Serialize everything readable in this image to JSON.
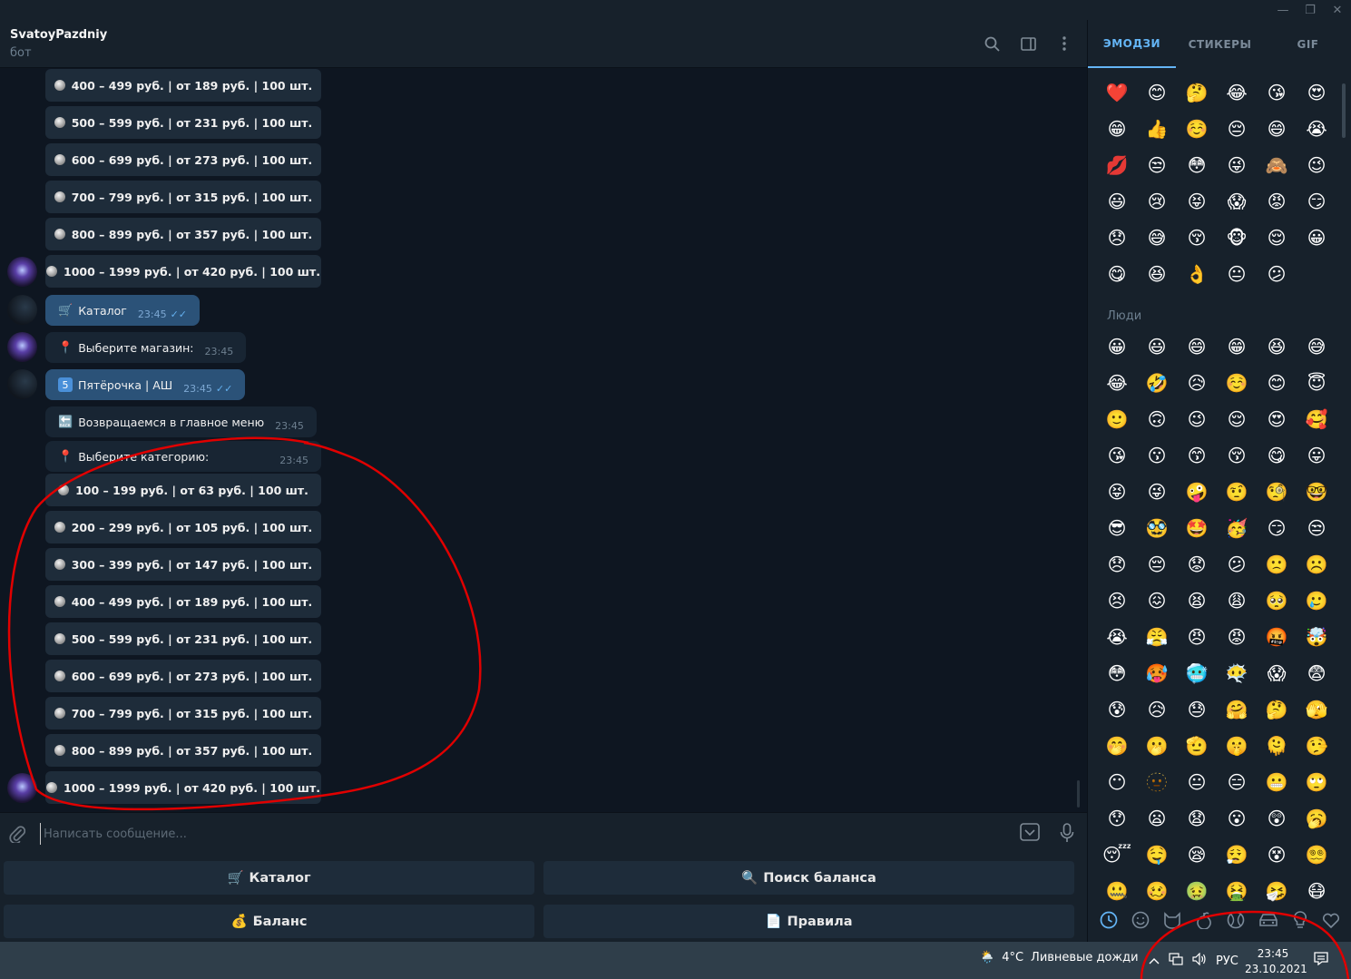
{
  "window": {
    "minimize": "—",
    "maximize": "❐",
    "close": "✕"
  },
  "chat": {
    "title": "SvatoyPazdniy",
    "subtitle": "бот"
  },
  "top_buttons": [
    "400 – 499 руб. | от 189 руб. | 100 шт.",
    "500 – 599 руб. | от 231 руб. | 100 шт.",
    "600 – 699 руб. | от 273 руб. | 100 шт.",
    "700 – 799 руб. | от 315 руб. | 100 шт.",
    "800 – 899 руб. | от 357 руб. | 100 шт.",
    "1000 – 1999 руб. | от 420 руб. | 100 шт."
  ],
  "messages": {
    "catalog": {
      "text": "Каталог",
      "time": "23:45"
    },
    "choose_shop": {
      "text": "Выберите магазин:",
      "time": "23:45"
    },
    "shop": {
      "num": "5",
      "text": "Пятёрочка | АШ",
      "time": "23:45"
    },
    "back": {
      "text": "Возвращаемся в главное меню",
      "time": "23:45"
    },
    "choose_category": {
      "text": "Выберите категорию:",
      "time": "23:45"
    }
  },
  "category_buttons": [
    "100 – 199 руб. | от 63 руб. | 100 шт.",
    "200 – 299 руб. | от 105 руб. | 100 шт.",
    "300 – 399 руб. | от 147 руб. | 100 шт.",
    "400 – 499 руб. | от 189 руб. | 100 шт.",
    "500 – 599 руб. | от 231 руб. | 100 шт.",
    "600 – 699 руб. | от 273 руб. | 100 шт.",
    "700 – 799 руб. | от 315 руб. | 100 шт.",
    "800 – 899 руб. | от 357 руб. | 100 шт.",
    "1000 – 1999 руб. | от 420 руб. | 100 шт."
  ],
  "composer": {
    "placeholder": "Написать сообщение..."
  },
  "keyboard": {
    "catalog": "Каталог",
    "balance_search": "Поиск баланса",
    "balance": "Баланс",
    "rules": "Правила"
  },
  "emoji_panel": {
    "tabs": [
      "ЭМОДЗИ",
      "СТИКЕРЫ",
      "GIF"
    ],
    "recent": [
      "❤️",
      "😊",
      "🤔",
      "😂",
      "😘",
      "😍",
      "😁",
      "👍",
      "☺️",
      "😔",
      "😄",
      "😭",
      "💋",
      "😒",
      "😳",
      "😜",
      "🙈",
      "😉",
      "😃",
      "😢",
      "😝",
      "😱",
      "😡",
      "😏",
      "😞",
      "😅",
      "😚",
      "🐵",
      "😌",
      "😀",
      "😋",
      "😆",
      "👌",
      "😐",
      "😕"
    ],
    "section_people": "Люди",
    "people": [
      "😀",
      "😃",
      "😄",
      "😁",
      "😆",
      "😅",
      "😂",
      "🤣",
      "😥",
      "☺️",
      "😊",
      "😇",
      "🙂",
      "🙃",
      "😉",
      "😌",
      "😍",
      "🥰",
      "😘",
      "😗",
      "😙",
      "😚",
      "😋",
      "😛",
      "😝",
      "😜",
      "🤪",
      "🤨",
      "🧐",
      "🤓",
      "😎",
      "🥸",
      "🤩",
      "🥳",
      "😏",
      "😒",
      "😞",
      "😔",
      "😟",
      "😕",
      "🙁",
      "☹️",
      "😣",
      "😖",
      "😫",
      "😩",
      "🥺",
      "🥲",
      "😭",
      "😤",
      "😠",
      "😡",
      "🤬",
      "🤯",
      "😳",
      "🥵",
      "🥶",
      "😶‍🌫️",
      "😱",
      "😨",
      "😰",
      "😥",
      "😓",
      "🤗",
      "🤔",
      "🫣",
      "🤭",
      "🫢",
      "🫡",
      "🤫",
      "🫠",
      "🤥",
      "😶",
      "🫥",
      "😐",
      "😑",
      "😬",
      "🙄",
      "😯",
      "😦",
      "😧",
      "😮",
      "😲",
      "🥱",
      "😴",
      "🤤",
      "😪",
      "😮‍💨",
      "😵",
      "😵‍💫",
      "🤐",
      "🥴",
      "🤢",
      "🤮",
      "🤧",
      "😷",
      "🤒",
      "🤕",
      "🤑",
      "🤠",
      "😈",
      "👿"
    ]
  },
  "taskbar": {
    "temp": "4°C",
    "weather": "Ливневые дожди",
    "lang": "РУС",
    "time": "23:45",
    "date": "23.10.2021"
  }
}
